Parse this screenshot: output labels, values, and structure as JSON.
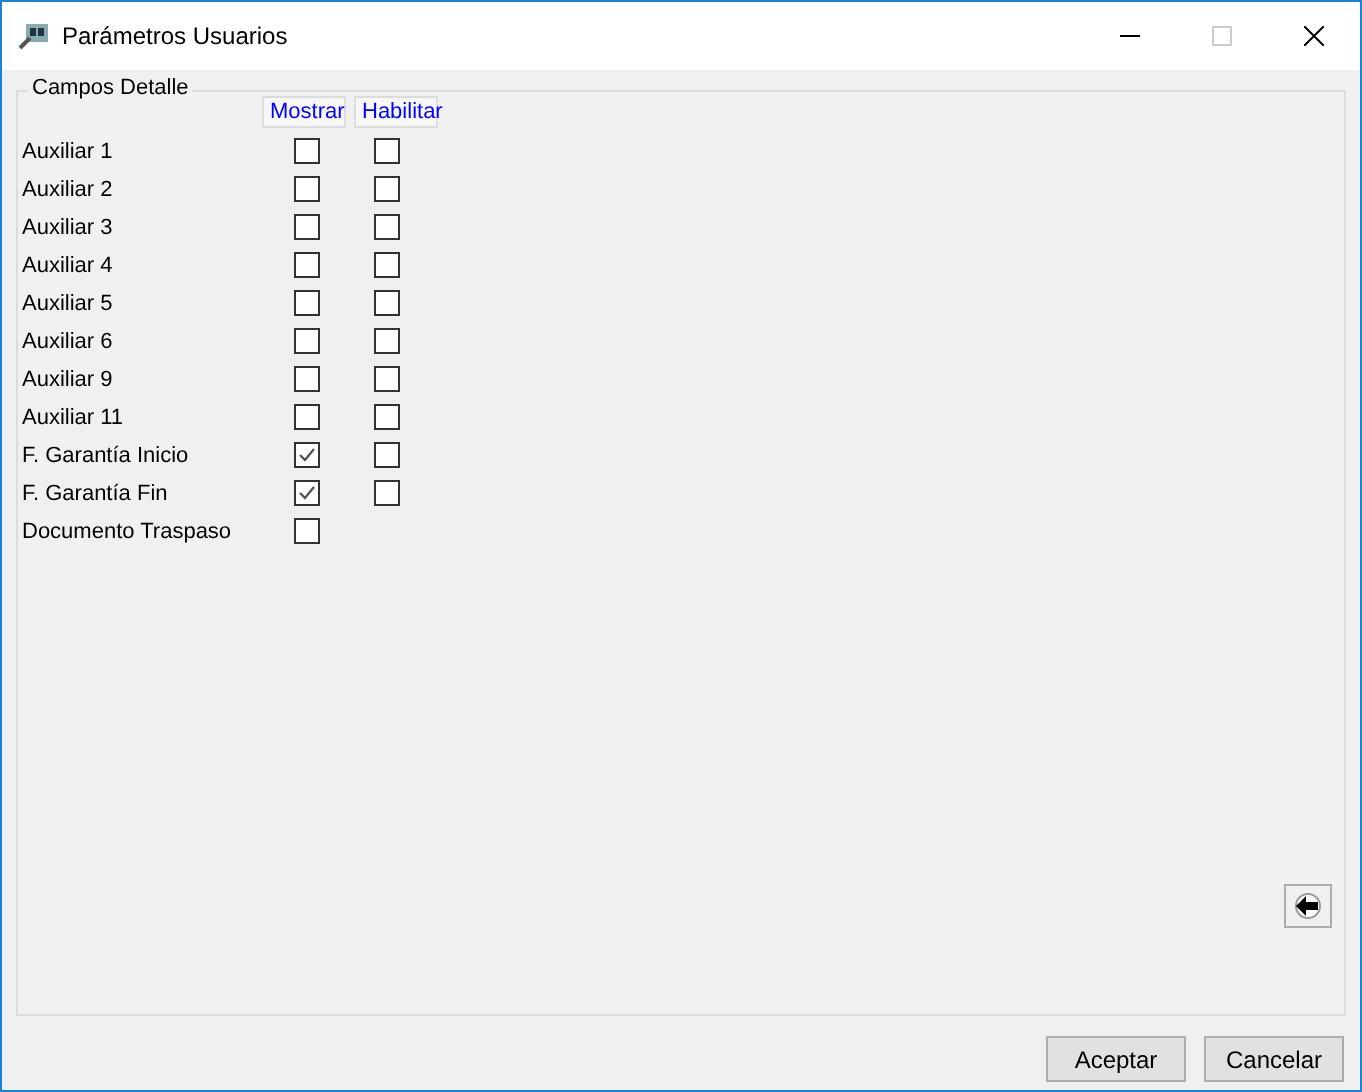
{
  "window": {
    "title": "Parámetros Usuarios"
  },
  "group": {
    "title": "Campos Detalle",
    "columns": [
      "Mostrar",
      "Habilitar"
    ],
    "rows": [
      {
        "label": "Auxiliar 1",
        "show": false,
        "enable": false
      },
      {
        "label": "Auxiliar 2",
        "show": false,
        "enable": false
      },
      {
        "label": "Auxiliar 3",
        "show": false,
        "enable": false
      },
      {
        "label": "Auxiliar 4",
        "show": false,
        "enable": false
      },
      {
        "label": "Auxiliar 5",
        "show": false,
        "enable": false
      },
      {
        "label": "Auxiliar 6",
        "show": false,
        "enable": false
      },
      {
        "label": "Auxiliar 9",
        "show": false,
        "enable": false
      },
      {
        "label": "Auxiliar 11",
        "show": false,
        "enable": false
      },
      {
        "label": "F. Garantía Inicio",
        "show": true,
        "enable": false
      },
      {
        "label": "F. Garantía Fin",
        "show": true,
        "enable": false
      },
      {
        "label": "Documento Traspaso",
        "show": false
      }
    ]
  },
  "buttons": [
    "Aceptar",
    "Cancelar"
  ]
}
